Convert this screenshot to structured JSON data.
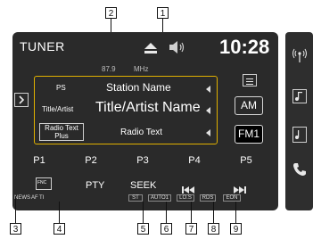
{
  "header": {
    "source_label": "TUNER",
    "clock": "10:28",
    "frequency": "87.9",
    "frequency_unit": "MHz"
  },
  "info_rows": [
    {
      "key": "PS",
      "value": "Station Name"
    },
    {
      "key": "Title/Artist",
      "value": "Title/Artist Name"
    },
    {
      "key": "Radio Text\nPlus",
      "value": "Radio Text"
    }
  ],
  "bands": {
    "am": "AM",
    "fm": "FM1"
  },
  "presets": [
    "P1",
    "P2",
    "P3",
    "P4",
    "P5"
  ],
  "controls": {
    "func": "FNC",
    "pty": "PTY",
    "seek": "SEEK"
  },
  "indicators": {
    "news": "NEWS",
    "af": "AF",
    "ti": "TI",
    "st": "ST",
    "auto": "AUTO1",
    "lo_s": "LO.S",
    "rds": "RDS",
    "eon": "EON"
  },
  "callouts": [
    "1",
    "2",
    "3",
    "4",
    "5",
    "6",
    "7",
    "8",
    "9"
  ],
  "icons": [
    "eject-icon",
    "mute-icon",
    "menu-icon",
    "expand-arrow-icon",
    "skip-back-icon",
    "skip-forward-icon",
    "antenna-icon",
    "music-icon",
    "video-icon",
    "phone-icon"
  ]
}
